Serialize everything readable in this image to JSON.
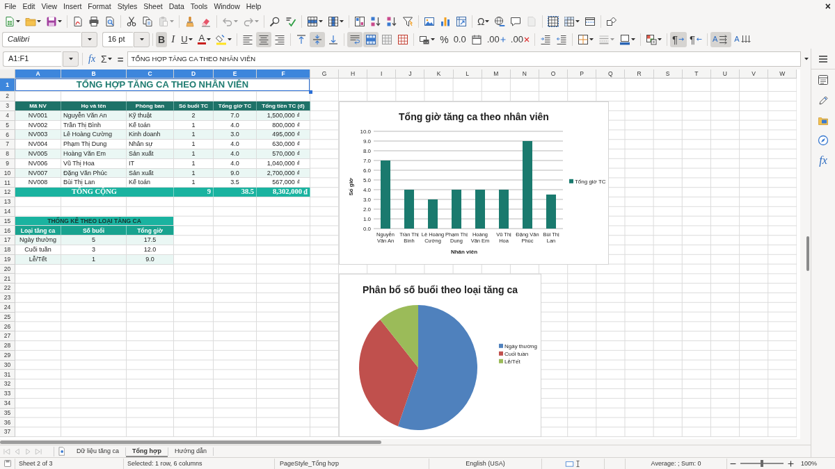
{
  "menu_bar": [
    "File",
    "Edit",
    "View",
    "Insert",
    "Format",
    "Styles",
    "Sheet",
    "Data",
    "Tools",
    "Window",
    "Help"
  ],
  "close_button": "×",
  "standard_toolbar": {
    "paste": {
      "disabled": true
    },
    "undo": {
      "disabled": true
    },
    "redo": {
      "disabled": true
    },
    "special_character": "Ω",
    "headers_footers": {
      "disabled": true
    }
  },
  "formatting_toolbar": {
    "font_name": "Calibri",
    "font_size": "16 pt",
    "bold": {
      "label": "B",
      "selected": true
    },
    "italic": {
      "label": "I",
      "selected": false
    },
    "underline": {
      "label": "U",
      "selected": false
    },
    "font_color": "A",
    "align_left": {
      "selected": false
    },
    "align_center": {
      "selected": true
    },
    "align_right": {
      "selected": false
    },
    "align_top": {
      "selected": false
    },
    "align_middle": {
      "selected": true
    },
    "align_bottom": {
      "selected": false
    },
    "wrap_text": {
      "selected": true
    },
    "merge_and_center": {
      "selected": true
    },
    "percent": "%",
    "number": "0.0",
    "add_decimal": ".00",
    "delete_decimal": ".00",
    "border_style": {
      "disabled": true
    },
    "left_to_right": {
      "label": "¶",
      "selected": true
    },
    "right_to_left": {
      "label": "¶",
      "selected": false
    },
    "text_horizontal": {
      "label": "A",
      "selected": true
    },
    "text_vertical": {
      "label": "A",
      "selected": false
    }
  },
  "formula_bar": {
    "name_box": "A1:F1",
    "function_wizard": "fx",
    "sum": "Σ",
    "equals": "=",
    "formula": "TỔNG HỢP TĂNG CA THEO NHÂN VIÊN"
  },
  "sidebar": {
    "functions": "fx"
  },
  "sheet": {
    "columns": [
      {
        "label": "A",
        "selected": true
      },
      {
        "label": "B",
        "selected": true
      },
      {
        "label": "C",
        "selected": true
      },
      {
        "label": "D",
        "selected": true
      },
      {
        "label": "E",
        "selected": true
      },
      {
        "label": "F",
        "selected": true
      },
      {
        "label": "G",
        "selected": false
      },
      {
        "label": "H",
        "selected": false
      },
      {
        "label": "I",
        "selected": false
      },
      {
        "label": "J",
        "selected": false
      },
      {
        "label": "K",
        "selected": false
      },
      {
        "label": "L",
        "selected": false
      },
      {
        "label": "M",
        "selected": false
      },
      {
        "label": "N",
        "selected": false
      },
      {
        "label": "O",
        "selected": false
      },
      {
        "label": "P",
        "selected": false
      },
      {
        "label": "Q",
        "selected": false
      },
      {
        "label": "R",
        "selected": false
      },
      {
        "label": "S",
        "selected": false
      },
      {
        "label": "T",
        "selected": false
      },
      {
        "label": "U",
        "selected": false
      },
      {
        "label": "V",
        "selected": false
      },
      {
        "label": "W",
        "selected": false
      }
    ],
    "rows": [
      {
        "label": "1",
        "selected": true
      },
      {
        "label": "2",
        "selected": false
      },
      {
        "label": "3",
        "selected": false
      },
      {
        "label": "4",
        "selected": false
      },
      {
        "label": "5",
        "selected": false
      },
      {
        "label": "6",
        "selected": false
      },
      {
        "label": "7",
        "selected": false
      },
      {
        "label": "8",
        "selected": false
      },
      {
        "label": "9",
        "selected": false
      },
      {
        "label": "10",
        "selected": false
      },
      {
        "label": "11",
        "selected": false
      },
      {
        "label": "12",
        "selected": false
      },
      {
        "label": "13",
        "selected": false
      },
      {
        "label": "14",
        "selected": false
      },
      {
        "label": "15",
        "selected": false
      },
      {
        "label": "16",
        "selected": false
      },
      {
        "label": "17",
        "selected": false
      },
      {
        "label": "18",
        "selected": false
      },
      {
        "label": "19",
        "selected": false
      },
      {
        "label": "20",
        "selected": false
      },
      {
        "label": "21",
        "selected": false
      },
      {
        "label": "22",
        "selected": false
      },
      {
        "label": "23",
        "selected": false
      },
      {
        "label": "24",
        "selected": false
      },
      {
        "label": "25",
        "selected": false
      },
      {
        "label": "26",
        "selected": false
      },
      {
        "label": "27",
        "selected": false
      },
      {
        "label": "28",
        "selected": false
      },
      {
        "label": "29",
        "selected": false
      },
      {
        "label": "30",
        "selected": false
      },
      {
        "label": "31",
        "selected": false
      },
      {
        "label": "32",
        "selected": false
      },
      {
        "label": "33",
        "selected": false
      },
      {
        "label": "34",
        "selected": false
      },
      {
        "label": "35",
        "selected": false
      },
      {
        "label": "36",
        "selected": false
      },
      {
        "label": "37",
        "selected": false
      }
    ],
    "title": {
      "text": "TỔNG HỢP TĂNG CA THEO NHÂN VIÊN",
      "selected": true
    },
    "main_table": {
      "headers": [
        "Mã NV",
        "Họ và tên",
        "Phòng ban",
        "Số buổi TC",
        "Tổng giờ TC",
        "Tổng tiền TC (đ)"
      ],
      "rows": [
        [
          "NV001",
          "Nguyễn Văn An",
          "Kỹ thuật",
          "2",
          "7.0",
          "1,500,000 ₫"
        ],
        [
          "NV002",
          "Trần Thị Bình",
          "Kế toán",
          "1",
          "4.0",
          "800,000 ₫"
        ],
        [
          "NV003",
          "Lê Hoàng Cường",
          "Kinh doanh",
          "1",
          "3.0",
          "495,000 ₫"
        ],
        [
          "NV004",
          "Phạm Thị Dung",
          "Nhân sự",
          "1",
          "4.0",
          "630,000 ₫"
        ],
        [
          "NV005",
          "Hoàng Văn Em",
          "Sản xuất",
          "1",
          "4.0",
          "570,000 ₫"
        ],
        [
          "NV006",
          "Vũ Thị Hoa",
          "IT",
          "1",
          "4.0",
          "1,040,000 ₫"
        ],
        [
          "NV007",
          "Đặng Văn Phúc",
          "Sản xuất",
          "1",
          "9.0",
          "2,700,000 ₫"
        ],
        [
          "NV008",
          "Bùi Thị Lan",
          "Kế toán",
          "1",
          "3.5",
          "567,000 ₫"
        ]
      ],
      "total": {
        "label": "TỔNG CỘNG",
        "values": [
          "9",
          "38.5",
          "8,302,000 ₫"
        ]
      }
    },
    "summary_table": {
      "title": "THỐNG KÊ THEO LOẠI TĂNG CA",
      "headers": [
        "Loại tăng ca",
        "Số buổi",
        "Tổng giờ"
      ],
      "rows": [
        [
          "Ngày thường",
          "5",
          "17.5"
        ],
        [
          "Cuối tuần",
          "3",
          "12.0"
        ],
        [
          "Lễ/Tết",
          "1",
          "9.0"
        ]
      ]
    }
  },
  "charts": [
    {
      "chart_data": {
        "type": "bar",
        "title": "Tổng giờ tăng ca theo nhân viên",
        "xlabel": "Nhân viên",
        "ylabel": "Số giờ",
        "categories": [
          "Nguyễn Văn An",
          "Trần Thị Bình",
          "Lê Hoàng Cường",
          "Phạm Thị Dung",
          "Hoàng Văn Em",
          "Vũ Thị Hoa",
          "Đặng Văn Phúc",
          "Bùi Thị Lan"
        ],
        "series": [
          {
            "name": "Tổng giờ TC",
            "color": "#1a7a6e",
            "values": [
              7,
              4,
              3,
              4,
              4,
              4,
              9,
              3.5
            ]
          }
        ],
        "ylim": [
          0,
          10
        ],
        "yticks": [
          {
            "value": 0,
            "label": "0.0"
          },
          {
            "value": 1,
            "label": "1.0"
          },
          {
            "value": 2,
            "label": "2.0"
          },
          {
            "value": 3,
            "label": "3.0"
          },
          {
            "value": 4,
            "label": "4.0"
          },
          {
            "value": 5,
            "label": "5.0"
          },
          {
            "value": 6,
            "label": "6.0"
          },
          {
            "value": 7,
            "label": "7.0"
          },
          {
            "value": 8,
            "label": "8.0"
          },
          {
            "value": 9,
            "label": "9.0"
          },
          {
            "value": 10,
            "label": "10.0"
          }
        ],
        "grid": true,
        "legend": true
      }
    },
    {
      "chart_data": {
        "type": "pie",
        "title": "Phân bổ số buổi theo loại tăng ca",
        "categories": [
          "Ngày thường",
          "Cuối tuần",
          "Lễ/Tết"
        ],
        "values": [
          55.56,
          33.33,
          11.11
        ],
        "colors": [
          "#4f81bd",
          "#c0504d",
          "#9bbb59"
        ],
        "legend": true
      }
    }
  ],
  "sheet_tabs": [
    {
      "label": "Dữ liệu tăng ca",
      "selected": false
    },
    {
      "label": "Tổng hợp",
      "selected": true
    },
    {
      "label": "Hướng dẫn",
      "selected": false
    }
  ],
  "status_bar": {
    "sheet": "Sheet 2 of 3",
    "selection": "Selected: 1 row, 6 columns",
    "page_style": "PageStyle_Tổng hợp",
    "language": "English (USA)",
    "functions": "Average: ; Sum: 0",
    "zoom": {
      "level": 0.5,
      "reading": "100%"
    }
  }
}
